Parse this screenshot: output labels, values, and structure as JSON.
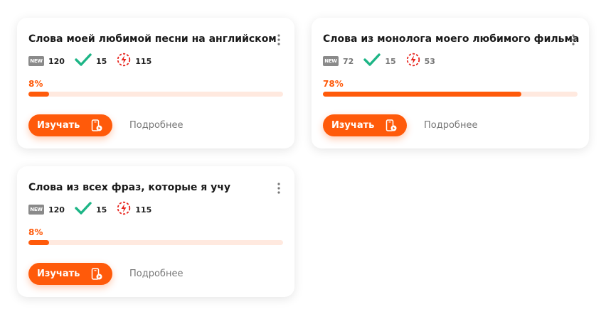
{
  "colors": {
    "accent": "#ff5a0a",
    "track": "#ffe9df",
    "check": "#1db586",
    "new_badge": "#8a8a8a"
  },
  "icons": [
    "new-badge-icon",
    "check-icon",
    "lightning-circle-icon",
    "kebab-menu-icon",
    "phone-play-icon"
  ],
  "cards": [
    {
      "title": "Слова моей любимой песни на английском",
      "new_badge": "NEW",
      "new_count": "120",
      "learned_count": "15",
      "repeat_count": "115",
      "progress_label": "8%",
      "progress_fraction": 0.08,
      "study_label": "Изучать",
      "details_label": "Подробнее"
    },
    {
      "title": "Слова из монолога моего любимого фильма",
      "new_badge": "NEW",
      "new_count": "72",
      "learned_count": "15",
      "repeat_count": "53",
      "progress_label": "78%",
      "progress_fraction": 0.78,
      "study_label": "Изучать",
      "details_label": "Подробнее"
    },
    {
      "title": "Слова из всех фраз, которые я учу",
      "new_badge": "NEW",
      "new_count": "120",
      "learned_count": "15",
      "repeat_count": "115",
      "progress_label": "8%",
      "progress_fraction": 0.08,
      "study_label": "Изучать",
      "details_label": "Подробнее"
    }
  ]
}
